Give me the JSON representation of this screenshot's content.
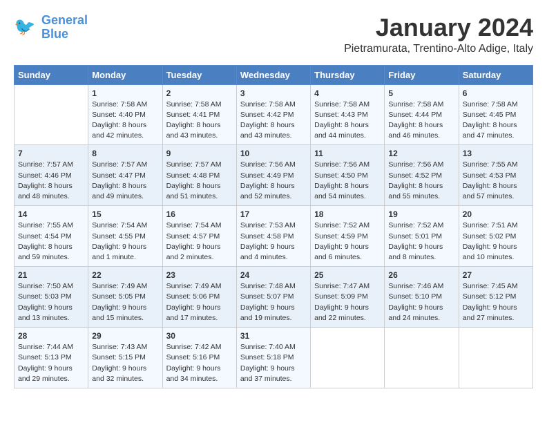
{
  "logo": {
    "line1": "General",
    "line2": "Blue"
  },
  "title": "January 2024",
  "location": "Pietramurata, Trentino-Alto Adige, Italy",
  "days_of_week": [
    "Sunday",
    "Monday",
    "Tuesday",
    "Wednesday",
    "Thursday",
    "Friday",
    "Saturday"
  ],
  "weeks": [
    [
      {
        "day": "",
        "info": ""
      },
      {
        "day": "1",
        "info": "Sunrise: 7:58 AM\nSunset: 4:40 PM\nDaylight: 8 hours\nand 42 minutes."
      },
      {
        "day": "2",
        "info": "Sunrise: 7:58 AM\nSunset: 4:41 PM\nDaylight: 8 hours\nand 43 minutes."
      },
      {
        "day": "3",
        "info": "Sunrise: 7:58 AM\nSunset: 4:42 PM\nDaylight: 8 hours\nand 43 minutes."
      },
      {
        "day": "4",
        "info": "Sunrise: 7:58 AM\nSunset: 4:43 PM\nDaylight: 8 hours\nand 44 minutes."
      },
      {
        "day": "5",
        "info": "Sunrise: 7:58 AM\nSunset: 4:44 PM\nDaylight: 8 hours\nand 46 minutes."
      },
      {
        "day": "6",
        "info": "Sunrise: 7:58 AM\nSunset: 4:45 PM\nDaylight: 8 hours\nand 47 minutes."
      }
    ],
    [
      {
        "day": "7",
        "info": "Sunrise: 7:57 AM\nSunset: 4:46 PM\nDaylight: 8 hours\nand 48 minutes."
      },
      {
        "day": "8",
        "info": "Sunrise: 7:57 AM\nSunset: 4:47 PM\nDaylight: 8 hours\nand 49 minutes."
      },
      {
        "day": "9",
        "info": "Sunrise: 7:57 AM\nSunset: 4:48 PM\nDaylight: 8 hours\nand 51 minutes."
      },
      {
        "day": "10",
        "info": "Sunrise: 7:56 AM\nSunset: 4:49 PM\nDaylight: 8 hours\nand 52 minutes."
      },
      {
        "day": "11",
        "info": "Sunrise: 7:56 AM\nSunset: 4:50 PM\nDaylight: 8 hours\nand 54 minutes."
      },
      {
        "day": "12",
        "info": "Sunrise: 7:56 AM\nSunset: 4:52 PM\nDaylight: 8 hours\nand 55 minutes."
      },
      {
        "day": "13",
        "info": "Sunrise: 7:55 AM\nSunset: 4:53 PM\nDaylight: 8 hours\nand 57 minutes."
      }
    ],
    [
      {
        "day": "14",
        "info": "Sunrise: 7:55 AM\nSunset: 4:54 PM\nDaylight: 8 hours\nand 59 minutes."
      },
      {
        "day": "15",
        "info": "Sunrise: 7:54 AM\nSunset: 4:55 PM\nDaylight: 9 hours\nand 1 minute."
      },
      {
        "day": "16",
        "info": "Sunrise: 7:54 AM\nSunset: 4:57 PM\nDaylight: 9 hours\nand 2 minutes."
      },
      {
        "day": "17",
        "info": "Sunrise: 7:53 AM\nSunset: 4:58 PM\nDaylight: 9 hours\nand 4 minutes."
      },
      {
        "day": "18",
        "info": "Sunrise: 7:52 AM\nSunset: 4:59 PM\nDaylight: 9 hours\nand 6 minutes."
      },
      {
        "day": "19",
        "info": "Sunrise: 7:52 AM\nSunset: 5:01 PM\nDaylight: 9 hours\nand 8 minutes."
      },
      {
        "day": "20",
        "info": "Sunrise: 7:51 AM\nSunset: 5:02 PM\nDaylight: 9 hours\nand 10 minutes."
      }
    ],
    [
      {
        "day": "21",
        "info": "Sunrise: 7:50 AM\nSunset: 5:03 PM\nDaylight: 9 hours\nand 13 minutes."
      },
      {
        "day": "22",
        "info": "Sunrise: 7:49 AM\nSunset: 5:05 PM\nDaylight: 9 hours\nand 15 minutes."
      },
      {
        "day": "23",
        "info": "Sunrise: 7:49 AM\nSunset: 5:06 PM\nDaylight: 9 hours\nand 17 minutes."
      },
      {
        "day": "24",
        "info": "Sunrise: 7:48 AM\nSunset: 5:07 PM\nDaylight: 9 hours\nand 19 minutes."
      },
      {
        "day": "25",
        "info": "Sunrise: 7:47 AM\nSunset: 5:09 PM\nDaylight: 9 hours\nand 22 minutes."
      },
      {
        "day": "26",
        "info": "Sunrise: 7:46 AM\nSunset: 5:10 PM\nDaylight: 9 hours\nand 24 minutes."
      },
      {
        "day": "27",
        "info": "Sunrise: 7:45 AM\nSunset: 5:12 PM\nDaylight: 9 hours\nand 27 minutes."
      }
    ],
    [
      {
        "day": "28",
        "info": "Sunrise: 7:44 AM\nSunset: 5:13 PM\nDaylight: 9 hours\nand 29 minutes."
      },
      {
        "day": "29",
        "info": "Sunrise: 7:43 AM\nSunset: 5:15 PM\nDaylight: 9 hours\nand 32 minutes."
      },
      {
        "day": "30",
        "info": "Sunrise: 7:42 AM\nSunset: 5:16 PM\nDaylight: 9 hours\nand 34 minutes."
      },
      {
        "day": "31",
        "info": "Sunrise: 7:40 AM\nSunset: 5:18 PM\nDaylight: 9 hours\nand 37 minutes."
      },
      {
        "day": "",
        "info": ""
      },
      {
        "day": "",
        "info": ""
      },
      {
        "day": "",
        "info": ""
      }
    ]
  ]
}
